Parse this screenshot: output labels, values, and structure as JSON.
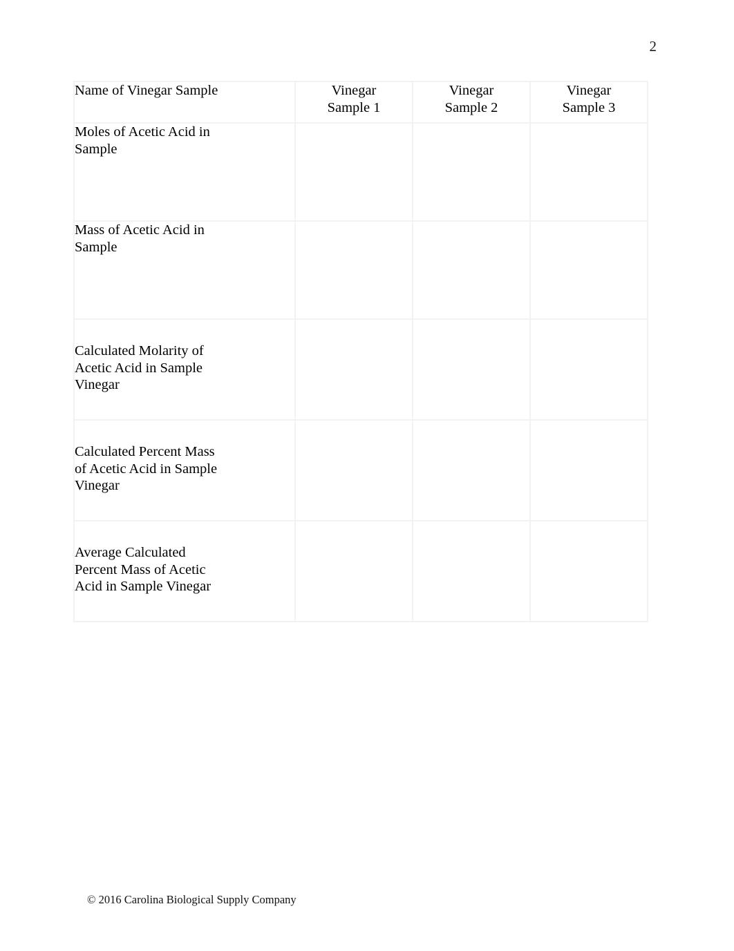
{
  "page": {
    "number": "2"
  },
  "table": {
    "columns": [
      {
        "id": "label",
        "header_lines": [
          "Name of Vinegar Sample"
        ]
      },
      {
        "id": "sample-1",
        "header_lines": [
          "Vinegar",
          "Sample 1"
        ]
      },
      {
        "id": "sample-2",
        "header_lines": [
          "Vinegar",
          "Sample 2"
        ]
      },
      {
        "id": "sample-3",
        "header_lines": [
          "Vinegar",
          "Sample 3"
        ]
      }
    ],
    "rows": [
      {
        "label_lines": [
          "Moles of Acetic Acid in",
          "Sample"
        ],
        "values": [
          "",
          "",
          ""
        ]
      },
      {
        "label_lines": [
          "Mass of Acetic Acid in",
          "Sample"
        ],
        "values": [
          "",
          "",
          ""
        ]
      },
      {
        "label_lines": [
          "Calculated Molarity of",
          "Acetic Acid in Sample",
          "Vinegar"
        ],
        "values": [
          "",
          "",
          ""
        ]
      },
      {
        "label_lines": [
          "Calculated Percent Mass",
          "of Acetic Acid in Sample",
          "Vinegar"
        ],
        "values": [
          "",
          "",
          ""
        ]
      },
      {
        "label_lines": [
          "Average Calculated",
          "Percent Mass of Acetic",
          "Acid in Sample Vinegar"
        ],
        "values": [
          "",
          "",
          ""
        ]
      }
    ]
  },
  "footer": {
    "copyright": "© 2016 Carolina Biological Supply Company"
  },
  "colors": {
    "page_background": "#ffffff",
    "text": "#000000",
    "table_border": "#f2f2f2"
  }
}
